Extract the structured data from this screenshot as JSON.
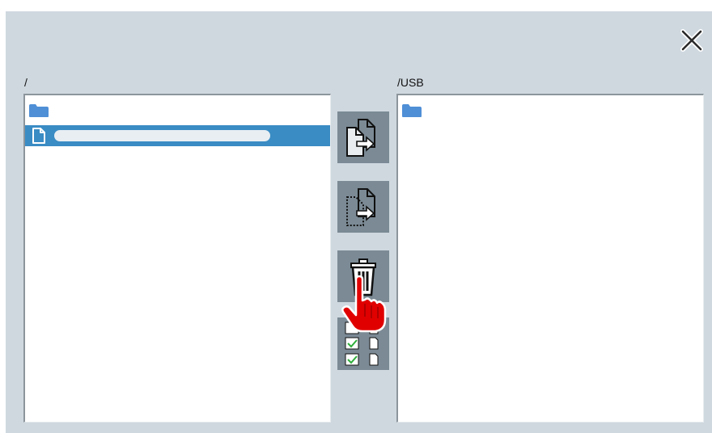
{
  "left_panel": {
    "path": "/"
  },
  "right_panel": {
    "path": "/USB"
  },
  "icons": {
    "close": "close-icon",
    "folder": "folder-icon",
    "file": "file-icon",
    "copy": "copy-file-icon",
    "move": "move-file-icon",
    "delete": "trash-icon",
    "select_all": "select-all-files-icon",
    "pointer": "hand-pointer-icon"
  },
  "colors": {
    "dialog_bg": "#cfd8df",
    "button_bg": "#7b8a95",
    "selection": "#3a8cc4",
    "folder": "#4f8fd6",
    "pointer": "#e00000"
  }
}
